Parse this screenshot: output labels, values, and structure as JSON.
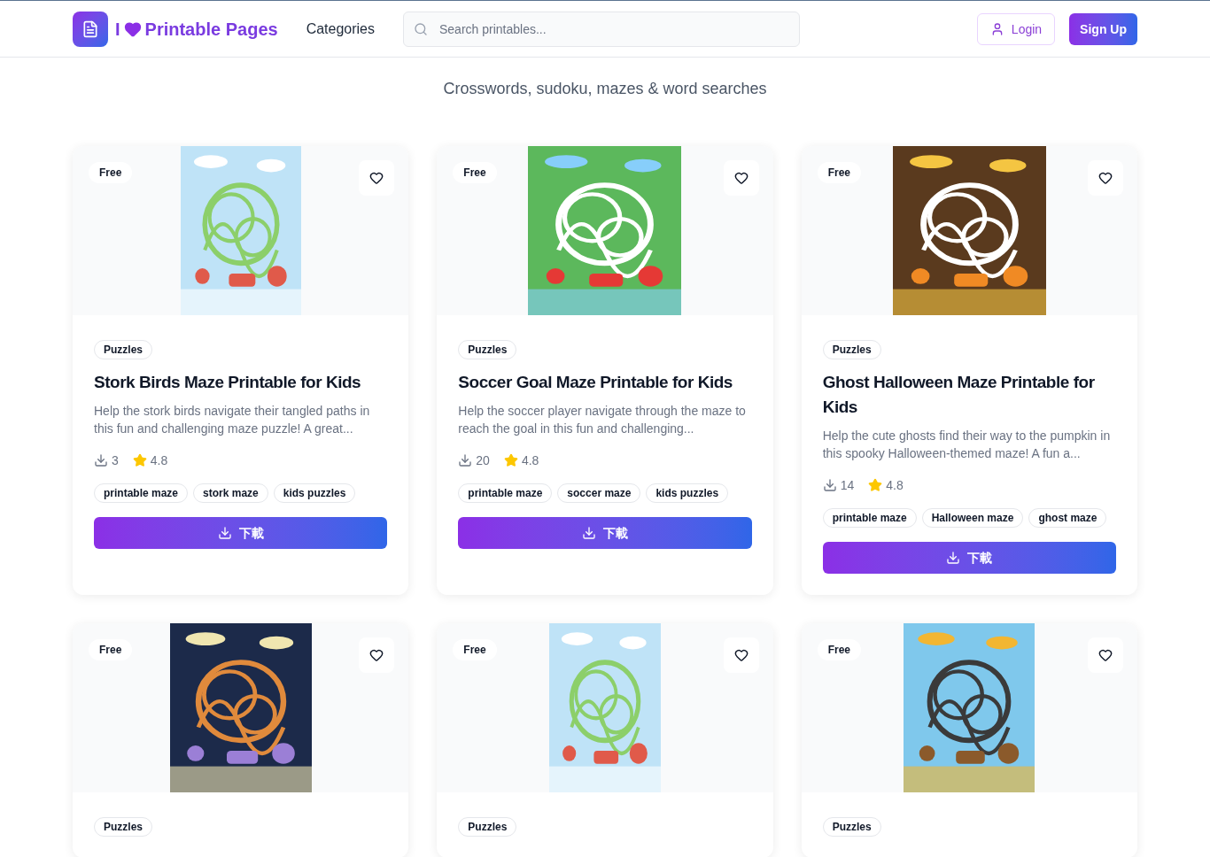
{
  "header": {
    "brand": {
      "prefix": "I",
      "name": "Printable Pages"
    },
    "nav": [
      {
        "label": "Categories"
      }
    ],
    "search": {
      "placeholder": "Search printables..."
    },
    "login": "Login",
    "signup": "Sign Up"
  },
  "subtitle": "Crosswords, sudoku, mazes & word searches",
  "cards": [
    {
      "badge": "Free",
      "category": "Puzzles",
      "title": "Stork Birds Maze Printable for Kids",
      "description": "Help the stork birds navigate their tangled paths in this fun and challenging maze puzzle! A great...",
      "downloads": "3",
      "rating": "4.8",
      "tags": [
        "printable maze",
        "stork maze",
        "kids puzzles"
      ],
      "button": "下載"
    },
    {
      "badge": "Free",
      "category": "Puzzles",
      "title": "Soccer Goal Maze Printable for Kids",
      "description": "Help the soccer player navigate through the maze to reach the goal in this fun and challenging...",
      "downloads": "20",
      "rating": "4.8",
      "tags": [
        "printable maze",
        "soccer maze",
        "kids puzzles"
      ],
      "button": "下載"
    },
    {
      "badge": "Free",
      "category": "Puzzles",
      "title": "Ghost Halloween Maze Printable for Kids",
      "description": "Help the cute ghosts find their way to the pumpkin in this spooky Halloween-themed maze! A fun a...",
      "downloads": "14",
      "rating": "4.8",
      "tags": [
        "printable maze",
        "Halloween maze",
        "ghost maze"
      ],
      "button": "下載"
    },
    {
      "badge": "Free",
      "category": "Puzzles"
    },
    {
      "badge": "Free",
      "category": "Puzzles"
    },
    {
      "badge": "Free",
      "category": "Puzzles"
    }
  ]
}
